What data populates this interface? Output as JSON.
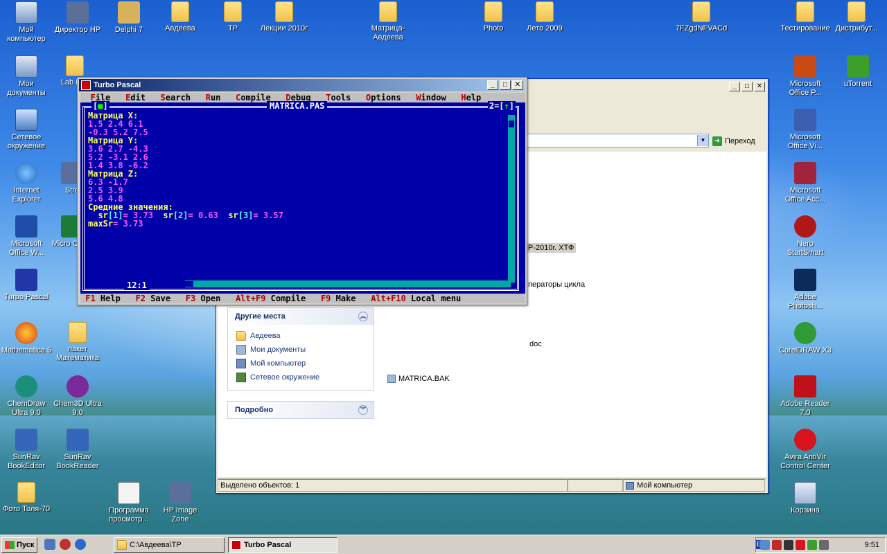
{
  "desktop": {
    "icons": [
      {
        "label": "Мой компьютер",
        "icon": "my-computer-icon"
      },
      {
        "label": "Директор HP",
        "icon": "hp-director-icon"
      },
      {
        "label": "Delphi 7",
        "icon": "delphi-icon"
      },
      {
        "label": "Авдеева",
        "icon": "folder-icon"
      },
      {
        "label": "ТР",
        "icon": "folder-icon"
      },
      {
        "label": "Лекции 2010г",
        "icon": "folder-icon"
      },
      {
        "label": "Матрица-Авдеева",
        "icon": "folder-icon"
      },
      {
        "label": "Photo",
        "icon": "folder-icon"
      },
      {
        "label": "Лето 2009",
        "icon": "folder-icon"
      },
      {
        "label": "7FZgdNFVACd",
        "icon": "folder-icon"
      },
      {
        "label": "Тестирование",
        "icon": "folder-icon"
      },
      {
        "label": "Дистрибут...",
        "icon": "folder-icon"
      },
      {
        "label": "Мои документы",
        "icon": "my-documents-icon"
      },
      {
        "label": "Lab Fun",
        "icon": "folder-icon"
      },
      {
        "label": "Сетевое окружение",
        "icon": "network-icon"
      },
      {
        "label": "Internet Explorer",
        "icon": "ie-icon"
      },
      {
        "label": "Stre",
        "icon": "app-icon"
      },
      {
        "label": "Microsoft Office W...",
        "icon": "word-icon"
      },
      {
        "label": "Micro Office",
        "icon": "excel-icon"
      },
      {
        "label": "Turbo Pascal",
        "icon": "turbo-pascal-icon"
      },
      {
        "label": "Mathematica 5",
        "icon": "mathematica-icon"
      },
      {
        "label": "пакет Математика",
        "icon": "folder-icon"
      },
      {
        "label": "ChemDraw Ultra 9.0",
        "icon": "chemdraw-icon"
      },
      {
        "label": "Chem3D Ultra 9.0",
        "icon": "chem3d-icon"
      },
      {
        "label": "SunRav BookEditor",
        "icon": "sunrav-editor-icon"
      },
      {
        "label": "SunRav BookReader",
        "icon": "sunrav-reader-icon"
      },
      {
        "label": "Фото Толя-70",
        "icon": "folder-icon"
      },
      {
        "label": "Программа просмотр...",
        "icon": "viewer-icon"
      },
      {
        "label": "HP Image Zone",
        "icon": "hp-image-zone-icon"
      },
      {
        "label": "Microsoft Office P...",
        "icon": "powerpoint-icon"
      },
      {
        "label": "uTorrent",
        "icon": "utorrent-icon"
      },
      {
        "label": "Microsoft Office Vi...",
        "icon": "visio-icon"
      },
      {
        "label": "Microsoft Office Acc...",
        "icon": "access-icon"
      },
      {
        "label": "Nero StartSmart",
        "icon": "nero-icon"
      },
      {
        "label": "Adobe Photosh...",
        "icon": "photoshop-icon"
      },
      {
        "label": "CorelDRAW X3",
        "icon": "coreldraw-icon"
      },
      {
        "label": "Adobe Reader 7.0",
        "icon": "adobe-reader-icon"
      },
      {
        "label": "Avira AntiVir Control Center",
        "icon": "avira-icon"
      },
      {
        "label": "Корзина",
        "icon": "recycle-bin-icon"
      }
    ]
  },
  "explorer": {
    "go_label": "Переход",
    "partial_texts": [
      "Р-2010г. ХТФ",
      "ператоры цикла",
      "doc"
    ],
    "file_bak": "MATRICA.BAK",
    "other_places_title": "Другие места",
    "other_places": [
      "Авдеева",
      "Мои документы",
      "Мой компьютер",
      "Сетевое окружение"
    ],
    "details_title": "Подробно",
    "status_left": "Выделено объектов: 1",
    "status_right": "Мой компьютер"
  },
  "turbo_pascal": {
    "window_title": "Turbo Pascal",
    "menu": [
      {
        "hot": "F",
        "rest": "ile"
      },
      {
        "hot": "E",
        "rest": "dit"
      },
      {
        "hot": "S",
        "rest": "earch"
      },
      {
        "hot": "R",
        "rest": "un"
      },
      {
        "hot": "C",
        "rest": "ompile"
      },
      {
        "hot": "D",
        "rest": "ebug"
      },
      {
        "hot": "T",
        "rest": "ools"
      },
      {
        "hot": "O",
        "rest": "ptions"
      },
      {
        "hot": "W",
        "rest": "indow"
      },
      {
        "hot": "H",
        "rest": "elp"
      }
    ],
    "file_name": "MATRICA.PAS",
    "close_box": "[■]",
    "window_number": "2=[↑]",
    "cursor_pos": "12:1",
    "lines": [
      {
        "parts": [
          {
            "t": "Матрица X:",
            "c": "yellow"
          }
        ]
      },
      {
        "parts": [
          {
            "t": "1.5 2.4 6.1",
            "c": "mag"
          }
        ]
      },
      {
        "parts": [
          {
            "t": "-0.3 5.2 7.5",
            "c": "mag"
          }
        ]
      },
      {
        "parts": [
          {
            "t": "Матрица Y:",
            "c": "yellow"
          }
        ]
      },
      {
        "parts": [
          {
            "t": "3.6 2.7 -4.3",
            "c": "mag"
          }
        ]
      },
      {
        "parts": [
          {
            "t": "5.2 -3.1 2.6",
            "c": "mag"
          }
        ]
      },
      {
        "parts": [
          {
            "t": "1.4 3.8 -6.2",
            "c": "mag"
          }
        ]
      },
      {
        "parts": [
          {
            "t": "Матрица Z:",
            "c": "yellow"
          }
        ]
      },
      {
        "parts": [
          {
            "t": "6.3 -1.7",
            "c": "mag"
          }
        ]
      },
      {
        "parts": [
          {
            "t": "2.5 3.9",
            "c": "mag"
          }
        ]
      },
      {
        "parts": [
          {
            "t": "5.6 4.8",
            "c": "mag"
          }
        ]
      },
      {
        "parts": [
          {
            "t": "Средние значения:",
            "c": "yellow"
          }
        ]
      },
      {
        "parts": [
          {
            "t": "  sr",
            "c": "yellow"
          },
          {
            "t": "[1]",
            "c": "cyan"
          },
          {
            "t": "= 3.73  ",
            "c": "mag"
          },
          {
            "t": "sr",
            "c": "yellow"
          },
          {
            "t": "[2]",
            "c": "cyan"
          },
          {
            "t": "= 0.63  ",
            "c": "mag"
          },
          {
            "t": "sr",
            "c": "yellow"
          },
          {
            "t": "[3]",
            "c": "cyan"
          },
          {
            "t": "= 3.57",
            "c": "mag"
          }
        ]
      },
      {
        "parts": [
          {
            "t": "maxSr",
            "c": "yellow"
          },
          {
            "t": "= 3.73",
            "c": "mag"
          }
        ]
      }
    ],
    "status": [
      {
        "key": "F1",
        "label": "Help"
      },
      {
        "key": "F2",
        "label": "Save"
      },
      {
        "key": "F3",
        "label": "Open"
      },
      {
        "key": "Alt+F9",
        "label": "Compile"
      },
      {
        "key": "F9",
        "label": "Make"
      },
      {
        "key": "Alt+F10",
        "label": "Local menu"
      }
    ]
  },
  "taskbar": {
    "start_label": "Пуск",
    "tasks": [
      {
        "label": "C:\\Авдеева\\ТР",
        "active": false
      },
      {
        "label": "Turbo Pascal",
        "active": true
      }
    ],
    "lang": "EN",
    "clock": "9:51"
  }
}
